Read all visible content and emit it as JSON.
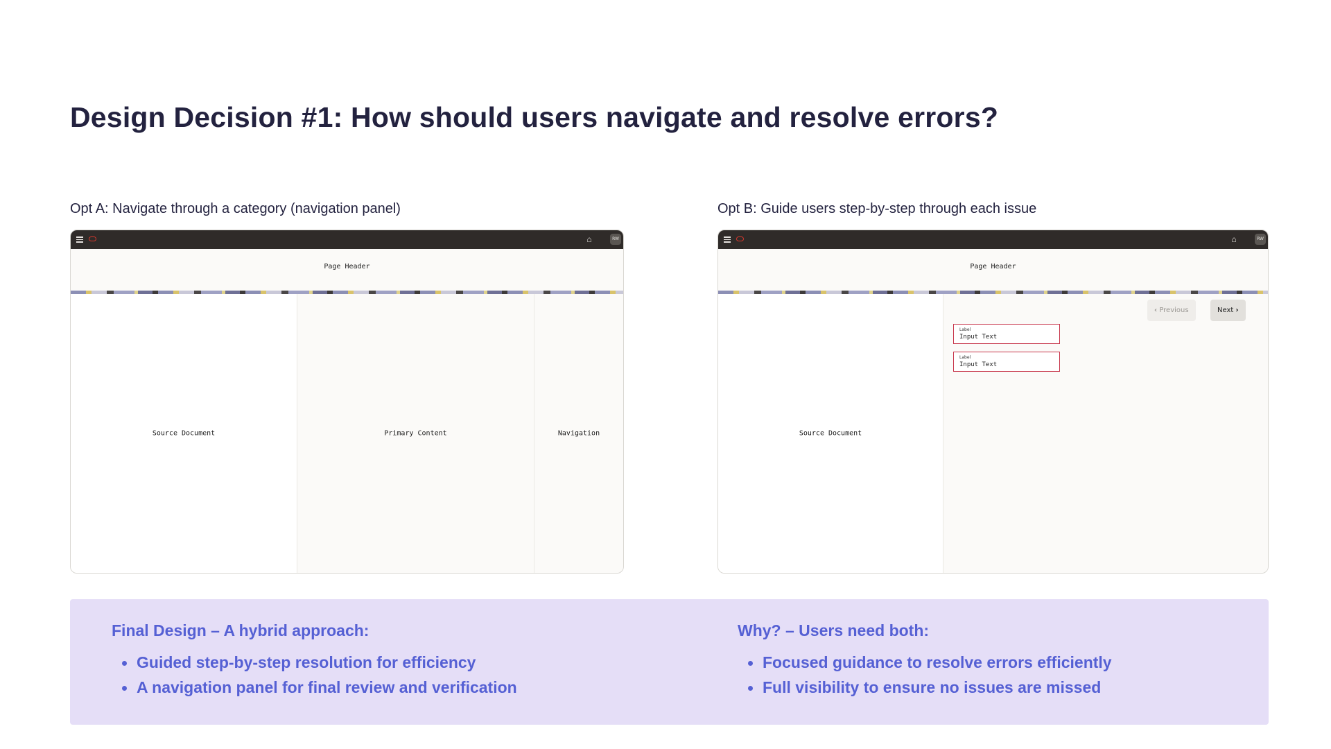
{
  "title": "Design Decision #1: How should users navigate and resolve errors?",
  "option_a": {
    "label": "Opt A: Navigate through a category (navigation panel)",
    "page_header": "Page Header",
    "avatar_text": "RW",
    "panes": [
      "Source Document",
      "Primary Content",
      "Navigation"
    ]
  },
  "option_b": {
    "label": "Opt B: Guide users step-by-step through each issue",
    "page_header": "Page Header",
    "avatar_text": "RW",
    "source_pane": "Source Document",
    "previous_label": "Previous",
    "next_label": "Next",
    "fields": [
      {
        "label": "Label",
        "value": "Input Text"
      },
      {
        "label": "Label",
        "value": "Input Text"
      }
    ]
  },
  "final": {
    "heading": "Final Design – A hybrid approach:",
    "bullets": [
      "Guided step-by-step resolution for efficiency",
      "A navigation panel for final review and verification"
    ]
  },
  "why": {
    "heading": "Why? – Users need both:",
    "bullets": [
      "Focused guidance to resolve errors efficiently",
      "Full visibility to ensure no issues are missed"
    ]
  },
  "colors": {
    "accent": "#5560d4",
    "banner_bg": "#e5def7",
    "topbar": "#2f2b29",
    "error_border": "#c7364b"
  },
  "icons": [
    "hamburger-icon",
    "brand-logo-icon",
    "home-icon",
    "chevron-left-icon",
    "chevron-right-icon"
  ]
}
